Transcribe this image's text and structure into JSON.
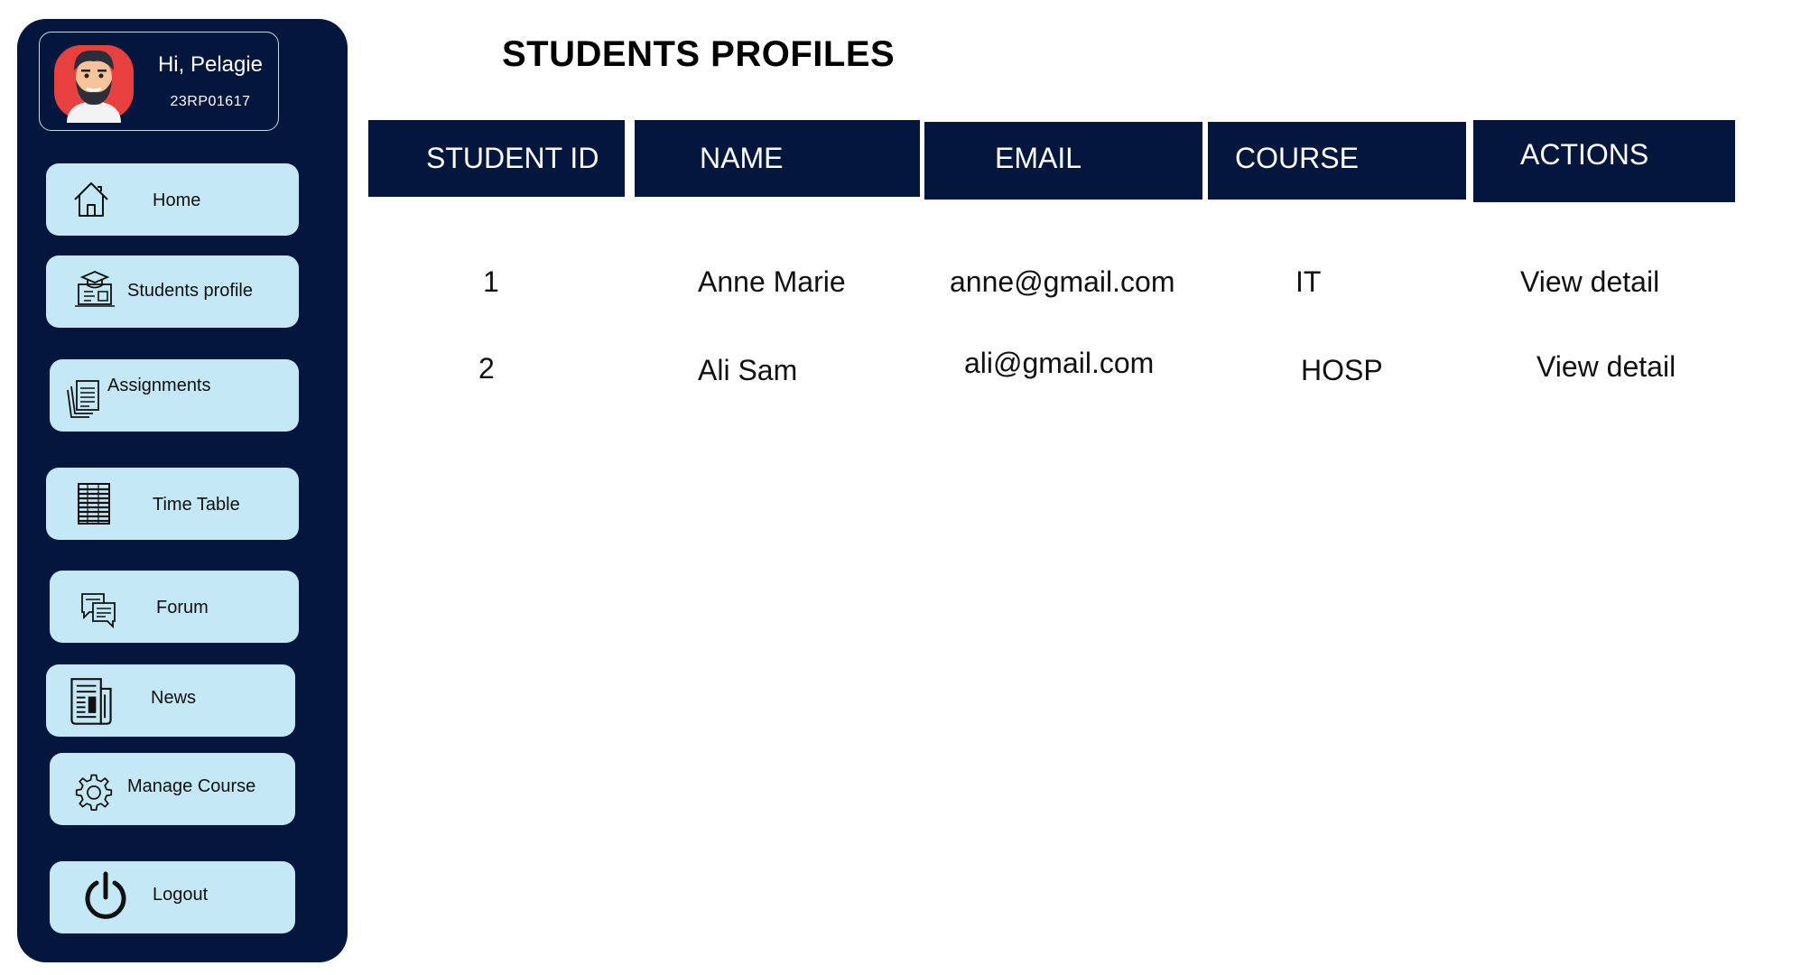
{
  "user": {
    "greeting": "Hi, Pelagie",
    "id": "23RP01617"
  },
  "nav": {
    "home": "Home",
    "students_profile": "Students profile",
    "assignments": "Assignments",
    "time_table": "Time Table",
    "forum": "Forum",
    "news": "News",
    "manage_course": "Manage Course",
    "logout": "Logout"
  },
  "page": {
    "title": "STUDENTS PROFILES"
  },
  "table": {
    "headers": [
      "STUDENT ID",
      "NAME",
      "EMAIL",
      "COURSE",
      "ACTIONS"
    ],
    "rows": [
      [
        "1",
        "Anne Marie",
        "anne@gmail.com",
        "IT",
        "View detail"
      ],
      [
        "2",
        "Ali Sam",
        "ali@gmail.com",
        "HOSP",
        "View detail"
      ]
    ]
  },
  "colors": {
    "sidebar": "#03173d",
    "button": "#c4e8f6",
    "header": "#03173d"
  }
}
